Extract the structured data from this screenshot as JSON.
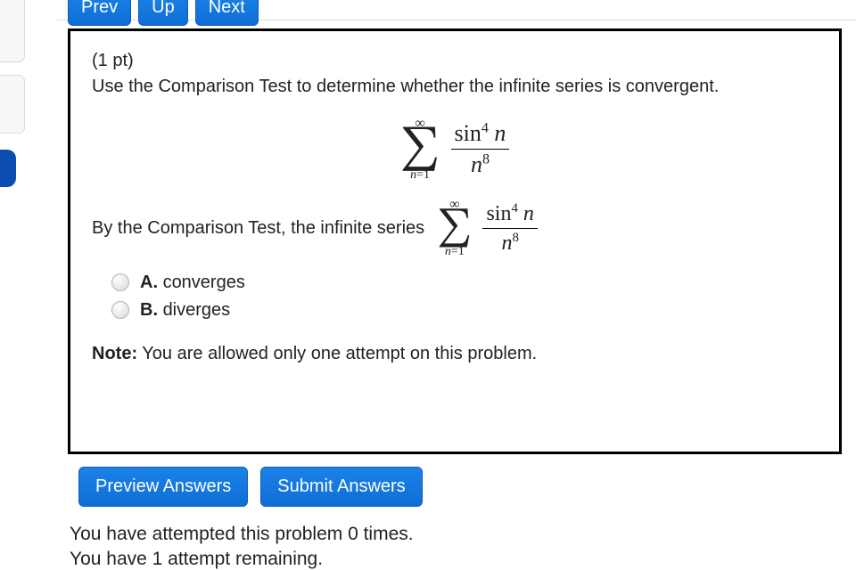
{
  "nav": {
    "prev": "Prev",
    "up": "Up",
    "next": "Next"
  },
  "problem": {
    "points": "(1 pt)",
    "prompt": "Use the Comparison Test to determine whether the infinite series is convergent.",
    "series": {
      "top": "∞",
      "bottom_var": "n",
      "bottom_eq": "=1",
      "num_fn": "sin",
      "num_exp": "4",
      "num_var": "n",
      "den_var": "n",
      "den_exp": "8"
    },
    "inline_lead": "By the Comparison Test, the infinite series",
    "choices": {
      "a_label": "A.",
      "a_text": "converges",
      "b_label": "B.",
      "b_text": "diverges"
    },
    "note_label": "Note:",
    "note_text": " You are allowed only one attempt on this problem."
  },
  "actions": {
    "preview": "Preview Answers",
    "submit": "Submit Answers"
  },
  "status": {
    "line1": "You have attempted this problem 0 times.",
    "line2": "You have 1 attempt remaining."
  }
}
